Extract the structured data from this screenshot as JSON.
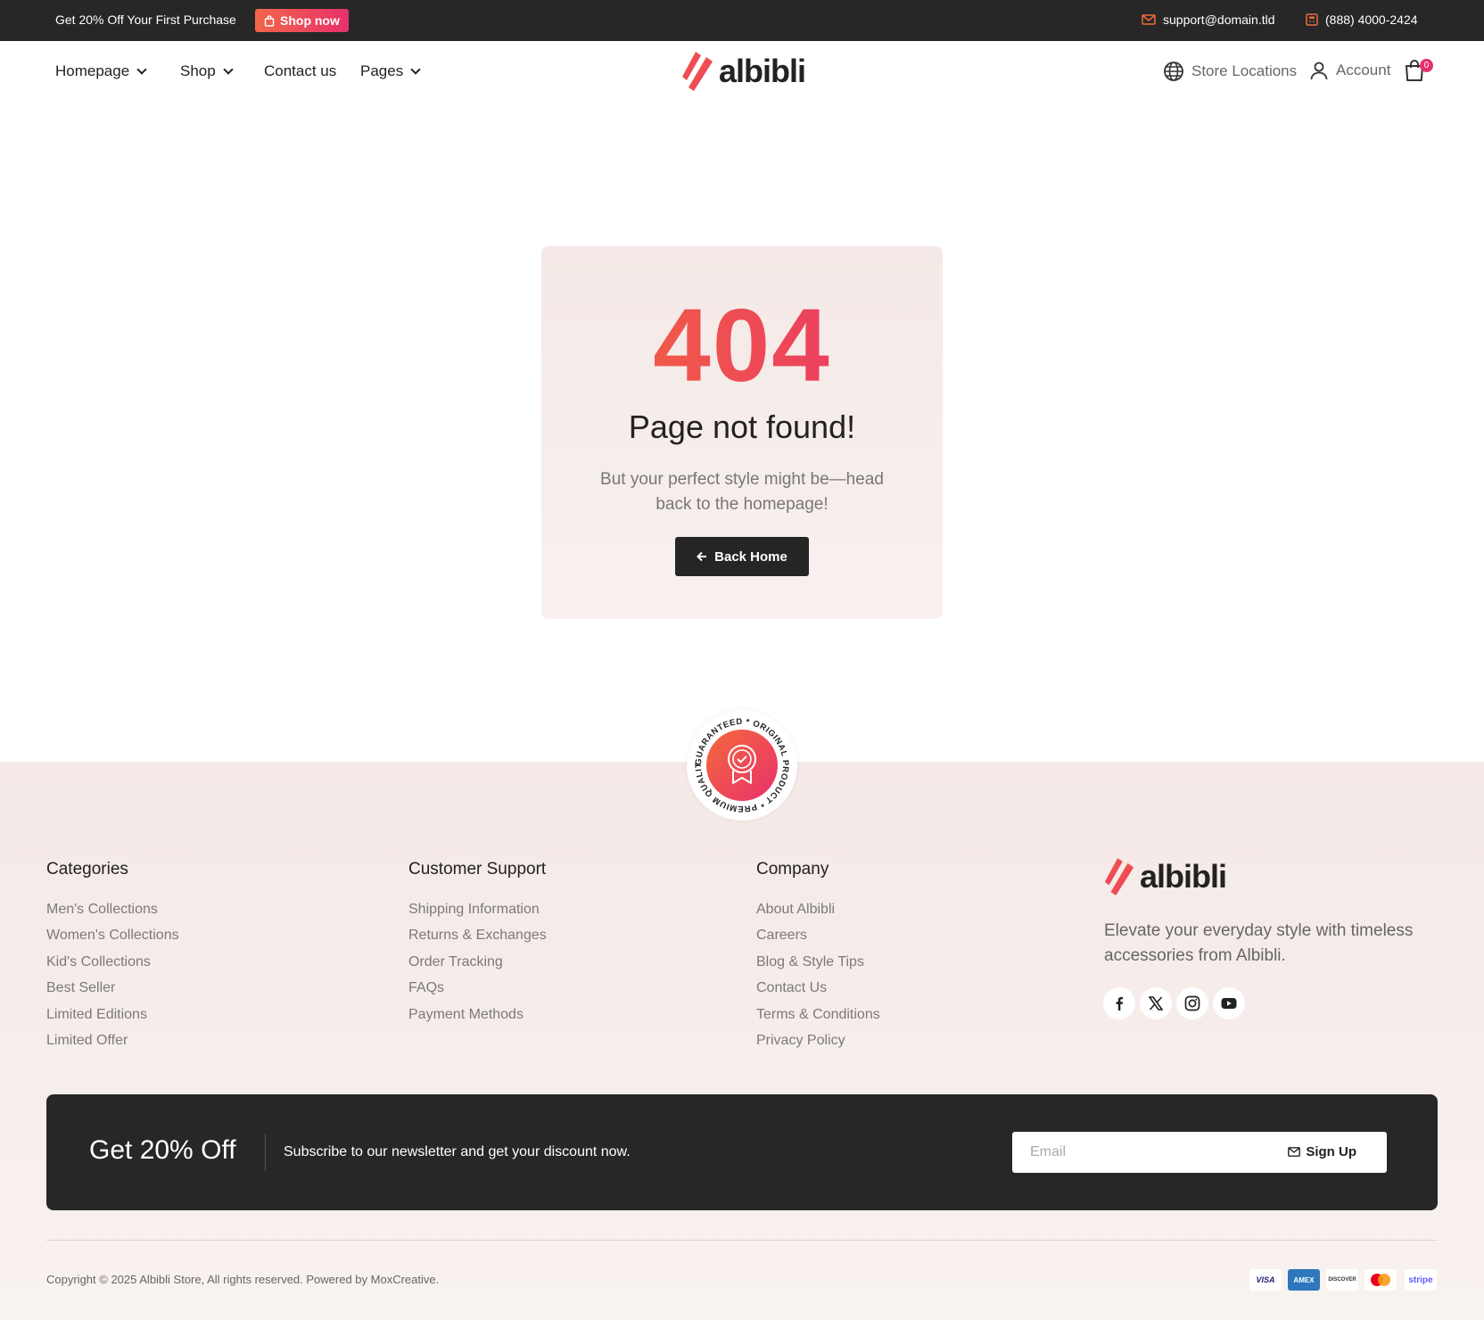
{
  "topbar": {
    "promo_text": "Get 20% Off Your First Purchase",
    "shop_now": "Shop now",
    "email": "support@domain.tld",
    "phone": "(888) 4000-2424"
  },
  "nav": {
    "items": [
      "Homepage",
      "Shop",
      "Contact us",
      "Pages"
    ],
    "logo_text": "albibli",
    "store_locations": "Store Locations",
    "account": "Account",
    "cart_count": "0"
  },
  "error_card": {
    "code": "404",
    "title": "Page not found!",
    "text": "But your perfect style might be—head back to the homepage!",
    "button": "Back Home"
  },
  "badge": {
    "ring_text": "GUARANTEED * ORIGINAL PRODUCT * PREMIUM QUALITY"
  },
  "footer": {
    "categories": {
      "title": "Categories",
      "items": [
        "Men's Collections",
        "Women's Collections",
        "Kid's Collections",
        "Best Seller",
        "Limited Editions",
        "Limited Offer"
      ]
    },
    "support": {
      "title": "Customer Support",
      "items": [
        "Shipping Information",
        "Returns & Exchanges",
        "Order Tracking",
        "FAQs",
        "Payment Methods"
      ]
    },
    "company": {
      "title": "Company",
      "items": [
        "About Albibli",
        "Careers",
        "Blog & Style Tips",
        "Contact Us",
        "Terms & Conditions",
        "Privacy Policy"
      ]
    },
    "logo_text": "albibli",
    "tagline": "Elevate your everyday style with timeless accessories from Albibli.",
    "social_icons": [
      "facebook-icon",
      "x-icon",
      "instagram-icon",
      "youtube-icon"
    ]
  },
  "newsletter": {
    "title": "Get 20% Off",
    "text": "Subscribe to our newsletter and get your discount now.",
    "email_placeholder": "Email",
    "signup": "Sign Up"
  },
  "bottom": {
    "copyright": "Copyright © 2025 Albibli Store, All rights reserved. Powered by MoxCreative.",
    "payments": [
      "VISA",
      "AMEX",
      "DISCOVER",
      "mastercard",
      "stripe"
    ]
  },
  "colors": {
    "accent_start": "#f4693c",
    "accent_end": "#e8306b",
    "dark": "#272727"
  }
}
